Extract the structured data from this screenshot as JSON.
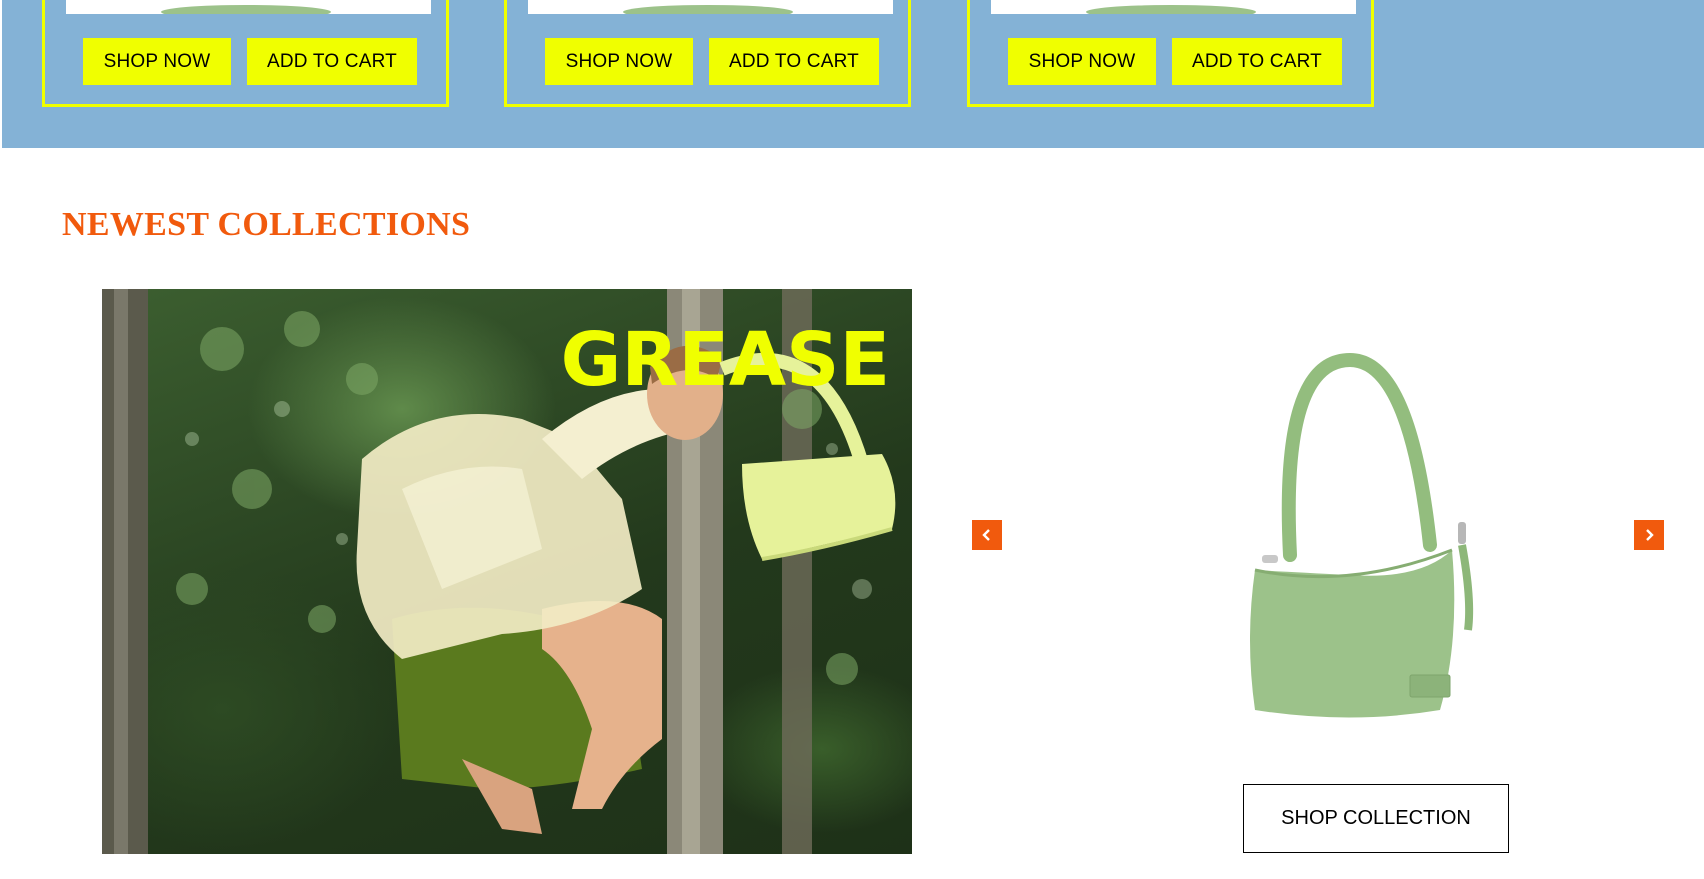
{
  "promo_band": {
    "background": "#84b2d6",
    "cards": [
      {
        "shop_label": "SHOP NOW",
        "cart_label": "ADD TO CART"
      },
      {
        "shop_label": "SHOP NOW",
        "cart_label": "ADD TO CART"
      },
      {
        "shop_label": "SHOP NOW",
        "cart_label": "ADD TO CART"
      }
    ]
  },
  "newest": {
    "title": "NEWEST COLLECTIONS",
    "hero_title": "GREASE",
    "prev_icon": "chevron-left-icon",
    "next_icon": "chevron-right-icon",
    "product_image": "green-shoulder-bag",
    "cta_label": "SHOP COLLECTION"
  },
  "colors": {
    "accent_yellow": "#f0ff00",
    "accent_orange": "#f15a0d",
    "band_blue": "#84b2d6",
    "bag_green": "#9cc28a"
  }
}
